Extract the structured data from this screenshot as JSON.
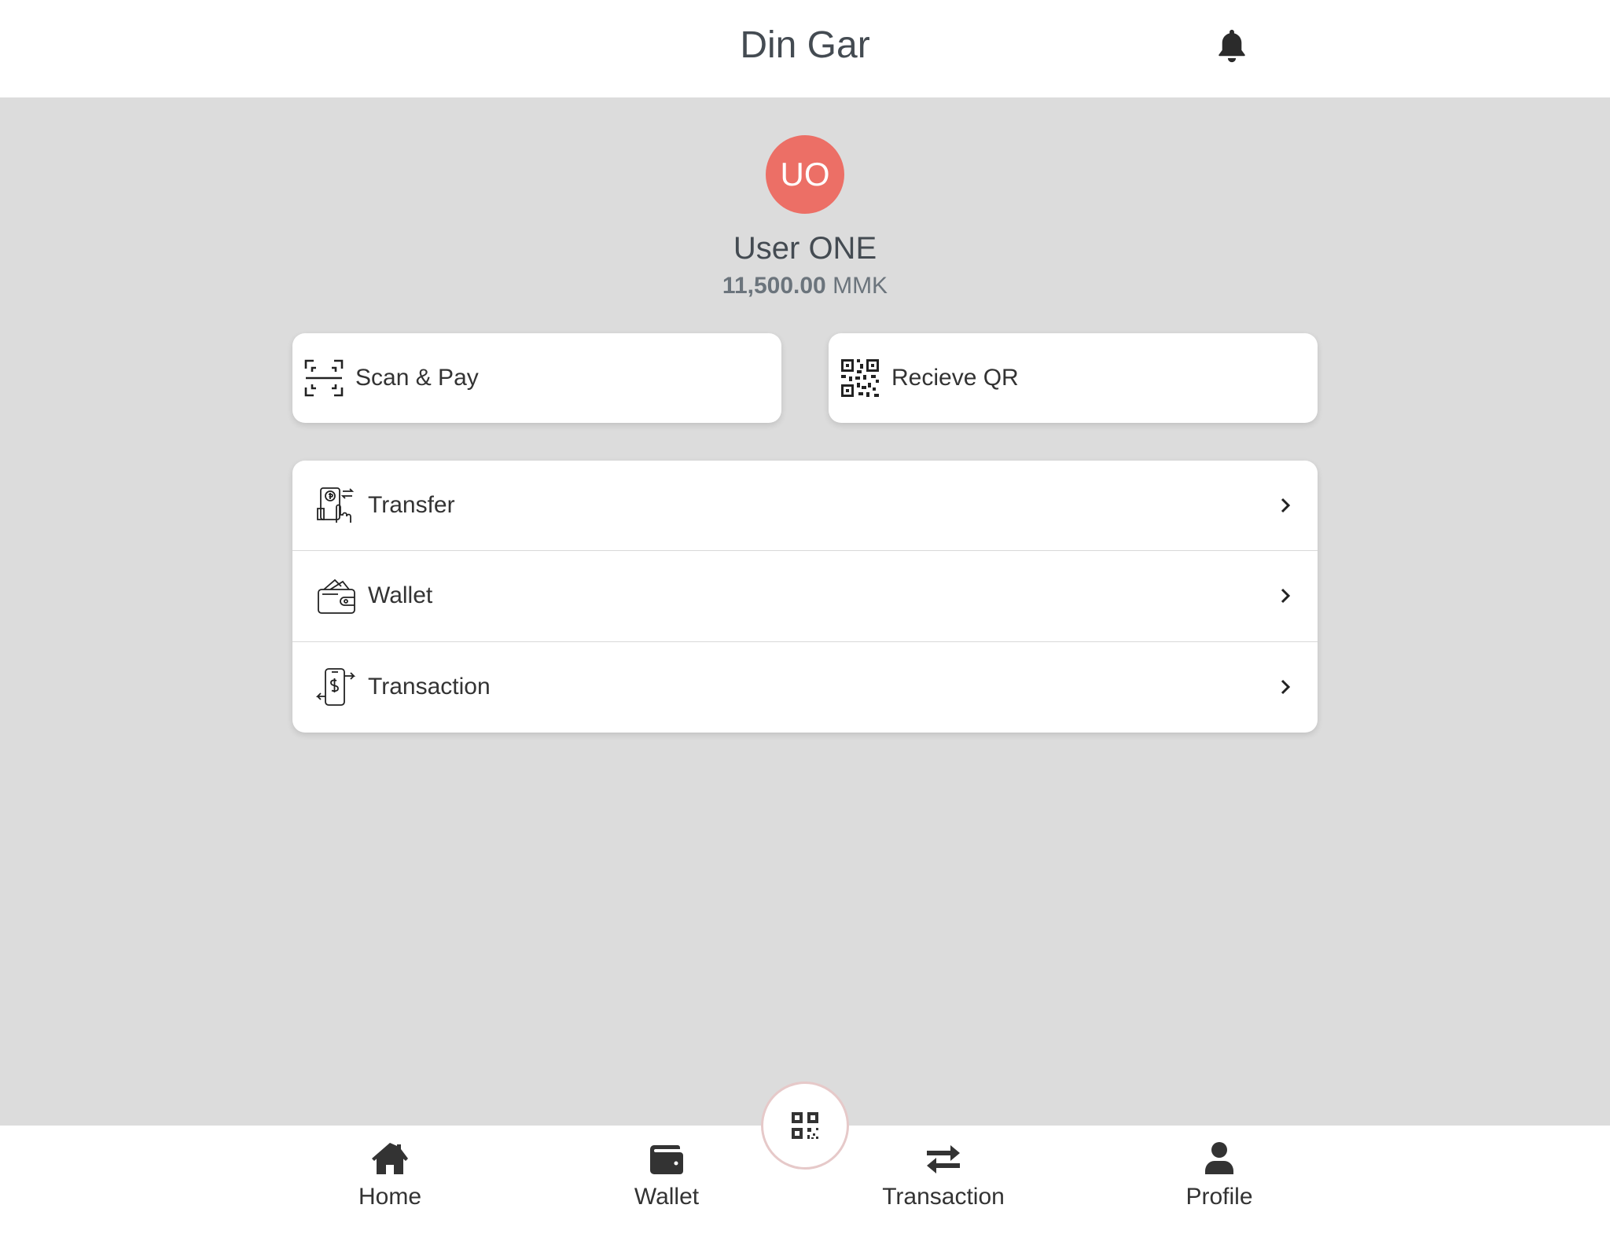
{
  "header": {
    "title": "Din Gar",
    "notification_icon": "bell-icon"
  },
  "profile": {
    "initials": "UO",
    "avatar_color": "#ec6f66",
    "name": "User ONE",
    "balance_amount": "11,500.00",
    "balance_currency": "MMK"
  },
  "actions": {
    "scan_pay": {
      "label": "Scan & Pay",
      "icon": "scan-icon"
    },
    "receive_qr": {
      "label": "Recieve QR",
      "icon": "qr-code-icon"
    }
  },
  "menu": {
    "items": [
      {
        "label": "Transfer",
        "icon": "transfer-icon"
      },
      {
        "label": "Wallet",
        "icon": "wallet-icon"
      },
      {
        "label": "Transaction",
        "icon": "transaction-icon"
      }
    ]
  },
  "bottom_nav": {
    "items": [
      {
        "label": "Home",
        "icon": "home-icon"
      },
      {
        "label": "Wallet",
        "icon": "wallet-icon"
      },
      {
        "label": "Transaction",
        "icon": "exchange-icon"
      },
      {
        "label": "Profile",
        "icon": "user-icon"
      }
    ],
    "center_button_icon": "qr-code-icon"
  }
}
